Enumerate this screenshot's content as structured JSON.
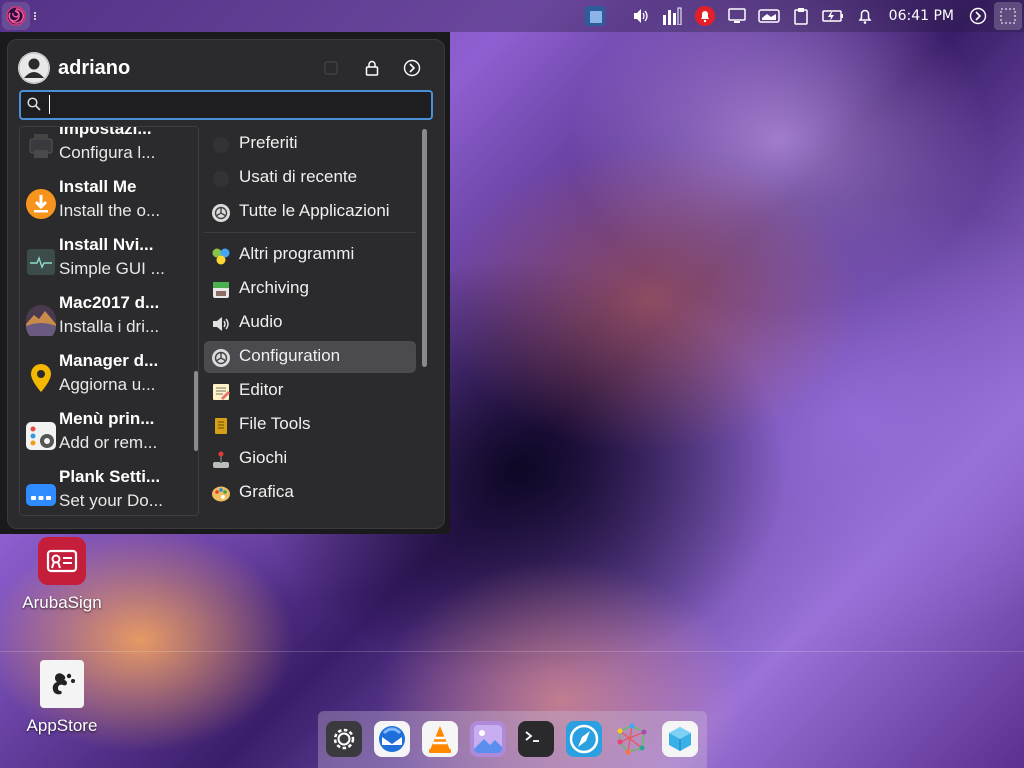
{
  "top_panel": {
    "clock": "06:41 PM"
  },
  "menu": {
    "username": "adriano",
    "search": {
      "value": "",
      "placeholder": ""
    },
    "favorites": [
      {
        "title": "Impostazi...",
        "subtitle": "Configura l...",
        "icon": "printer-settings-icon"
      },
      {
        "title": "Install Me",
        "subtitle": "Install the o...",
        "icon": "install-me-icon"
      },
      {
        "title": "Install Nvi...",
        "subtitle": "Simple GUI ...",
        "icon": "nvidia-monitor-icon"
      },
      {
        "title": "Mac2017 d...",
        "subtitle": "Installa i dri...",
        "icon": "macos-icon"
      },
      {
        "title": "Manager d...",
        "subtitle": "Aggiorna u...",
        "icon": "location-pin-icon"
      },
      {
        "title": "Menù prin...",
        "subtitle": "Add or rem...",
        "icon": "menu-settings-icon"
      },
      {
        "title": "Plank Setti...",
        "subtitle": "Set your Do...",
        "icon": "plank-dock-icon"
      }
    ],
    "categories": [
      {
        "label": "Preferiti",
        "icon": "favorites-icon"
      },
      {
        "label": "Usati di recente",
        "icon": "recent-icon"
      },
      {
        "label": "Tutte le Applicazioni",
        "icon": "all-apps-icon"
      },
      {
        "label": "Altri programmi",
        "icon": "other-programs-icon"
      },
      {
        "label": "Archiving",
        "icon": "archive-icon"
      },
      {
        "label": "Audio",
        "icon": "audio-icon"
      },
      {
        "label": "Configuration",
        "icon": "configuration-icon",
        "selected": true
      },
      {
        "label": "Editor",
        "icon": "editor-icon"
      },
      {
        "label": "File Tools",
        "icon": "file-tools-icon"
      },
      {
        "label": "Giochi",
        "icon": "games-icon"
      },
      {
        "label": "Grafica",
        "icon": "graphics-icon"
      }
    ]
  },
  "desktop": {
    "icons": [
      {
        "label": "ArubaSign",
        "icon": "arubasign-icon"
      },
      {
        "label": "AppStore",
        "icon": "appstore-icon"
      }
    ]
  },
  "dock": {
    "items": [
      {
        "icon": "settings-gear-icon"
      },
      {
        "icon": "thunderbird-icon"
      },
      {
        "icon": "vlc-icon"
      },
      {
        "icon": "image-viewer-icon"
      },
      {
        "icon": "terminal-icon"
      },
      {
        "icon": "safari-browser-icon"
      },
      {
        "icon": "network-graph-icon"
      },
      {
        "icon": "virtualbox-icon"
      }
    ]
  }
}
